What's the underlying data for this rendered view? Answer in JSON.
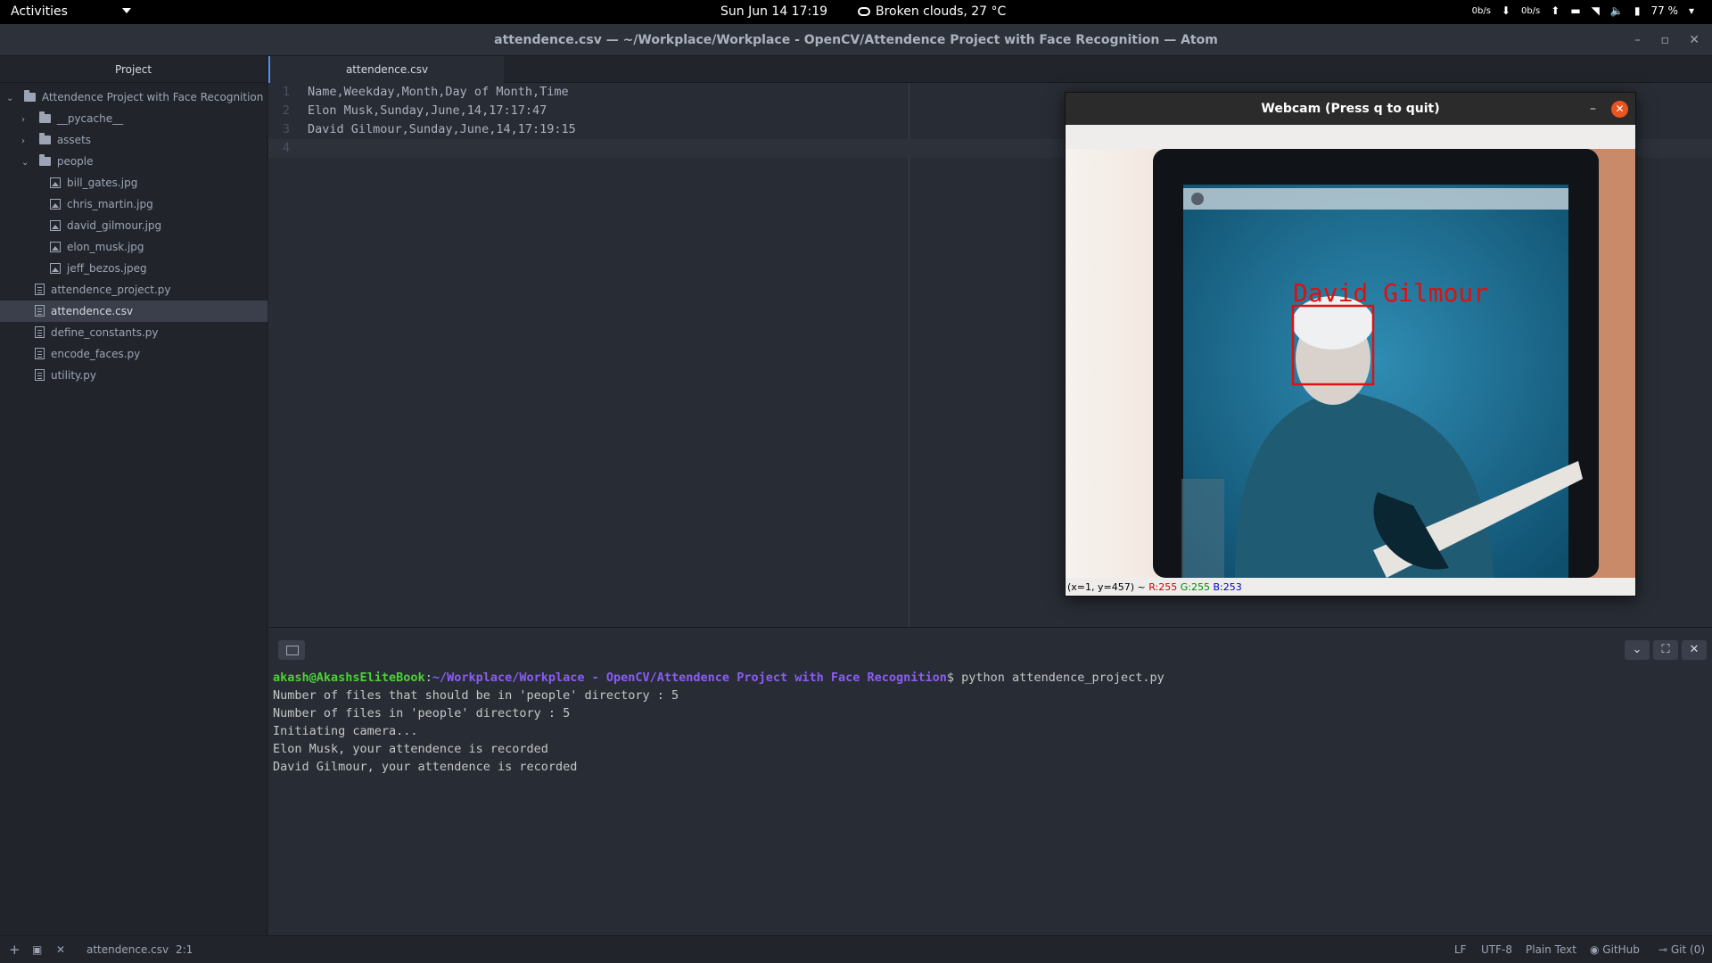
{
  "topbar": {
    "activities": "Activities",
    "clock": "Sun Jun 14  17:19",
    "weather": "Broken clouds, 27 °C",
    "net_down": "0b/s",
    "net_up": "0b/s",
    "battery": "77 %"
  },
  "window": {
    "title": "attendence.csv — ~/Workplace/Workplace - OpenCV/Attendence Project with Face Recognition — Atom"
  },
  "tree": {
    "header": "Project",
    "root": "Attendence Project with Face Recognition",
    "items": [
      {
        "label": "__pycache__",
        "kind": "folder"
      },
      {
        "label": "assets",
        "kind": "folder"
      },
      {
        "label": "people",
        "kind": "folder-open"
      },
      {
        "label": "bill_gates.jpg",
        "kind": "image"
      },
      {
        "label": "chris_martin.jpg",
        "kind": "image"
      },
      {
        "label": "david_gilmour.jpg",
        "kind": "image"
      },
      {
        "label": "elon_musk.jpg",
        "kind": "image"
      },
      {
        "label": "jeff_bezos.jpeg",
        "kind": "image"
      },
      {
        "label": "attendence_project.py",
        "kind": "file"
      },
      {
        "label": "attendence.csv",
        "kind": "file"
      },
      {
        "label": "define_constants.py",
        "kind": "file"
      },
      {
        "label": "encode_faces.py",
        "kind": "file"
      },
      {
        "label": "utility.py",
        "kind": "file"
      }
    ]
  },
  "editor": {
    "tab": "attendence.csv",
    "lines": [
      {
        "num": "1",
        "text": "Name,Weekday,Month,Day of Month,Time"
      },
      {
        "num": "2",
        "text": "Elon Musk,Sunday,June,14,17:17:47"
      },
      {
        "num": "3",
        "text": "David Gilmour,Sunday,June,14,17:19:15"
      },
      {
        "num": "4",
        "text": ""
      }
    ]
  },
  "webcam": {
    "title": "Webcam (Press q to quit)",
    "label": "David Gilmour",
    "status_pos": "(x=1, y=457) ~",
    "status_r": "R:255",
    "status_g": "G:255",
    "status_b": "B:253",
    "colors": {
      "box": "#e01010",
      "screen": "#1a6f94"
    }
  },
  "terminal": {
    "user": "akash@AkashsEliteBook",
    "colon": ":",
    "path": "~/Workplace/Workplace - OpenCV/Attendence Project with Face Recognition",
    "command": "$ python attendence_project.py",
    "output": [
      "Number of files that should be in 'people' directory : 5",
      "Number of files in 'people' directory : 5",
      "Initiating camera...",
      "Elon Musk, your attendence is recorded",
      "David Gilmour, your attendence is recorded"
    ]
  },
  "statusbar": {
    "file": "attendence.csv",
    "cursor": "2:1",
    "line_ending": "LF",
    "encoding": "UTF-8",
    "grammar": "Plain Text",
    "github": "GitHub",
    "git": "Git (0)"
  }
}
